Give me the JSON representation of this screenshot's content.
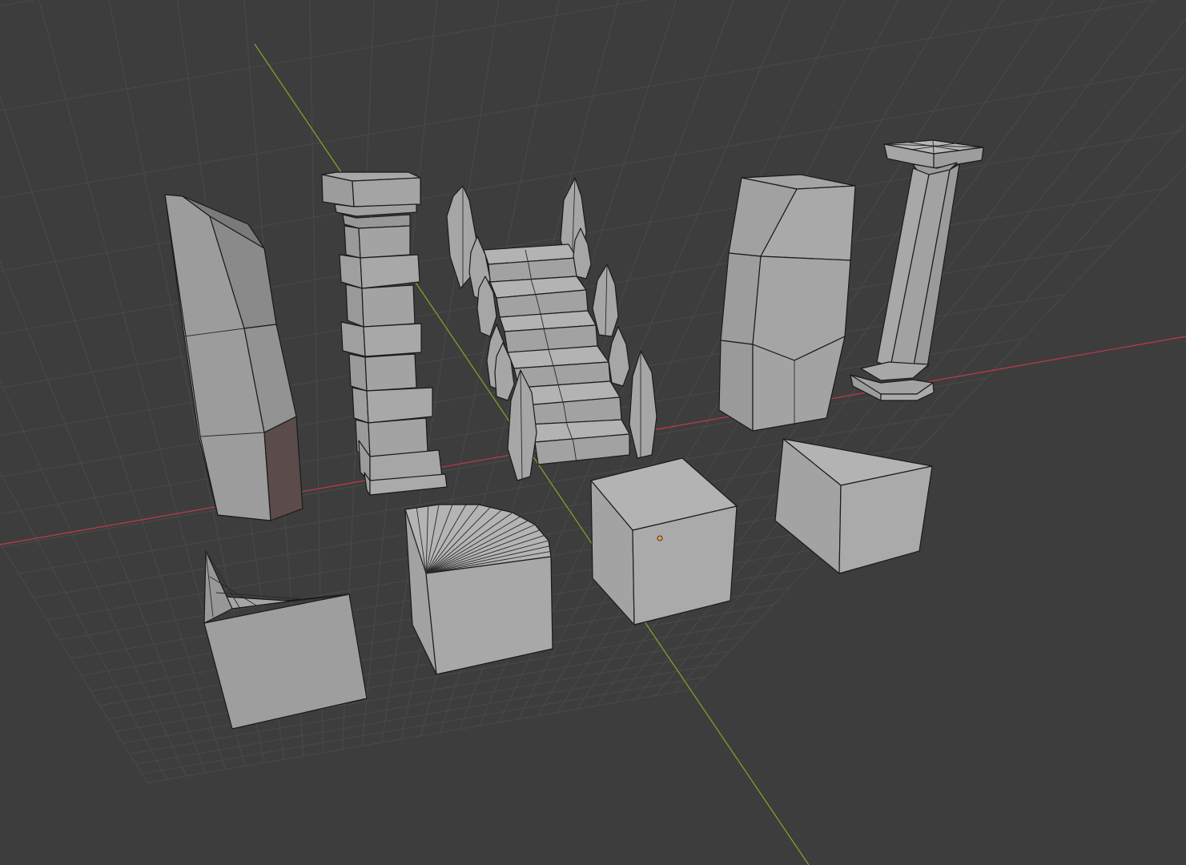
{
  "viewport": {
    "background": "#3d3d3d",
    "grid_color": "#4a4a4a",
    "x_axis_color": "#c0394a",
    "y_axis_color": "#7fa82c",
    "mesh_color": "#9a9a9a",
    "mesh_light": "#b0b0b0",
    "mesh_dark": "#7a7a7a",
    "wire_color": "#1a1a1a",
    "origin_color": "#e8a33a"
  },
  "objects": [
    "tall-angled-pillar",
    "stacked-column",
    "staircase-with-spikes",
    "tall-block",
    "classic-column",
    "sloped-block",
    "quarter-round-block",
    "cube",
    "wedge-block"
  ]
}
